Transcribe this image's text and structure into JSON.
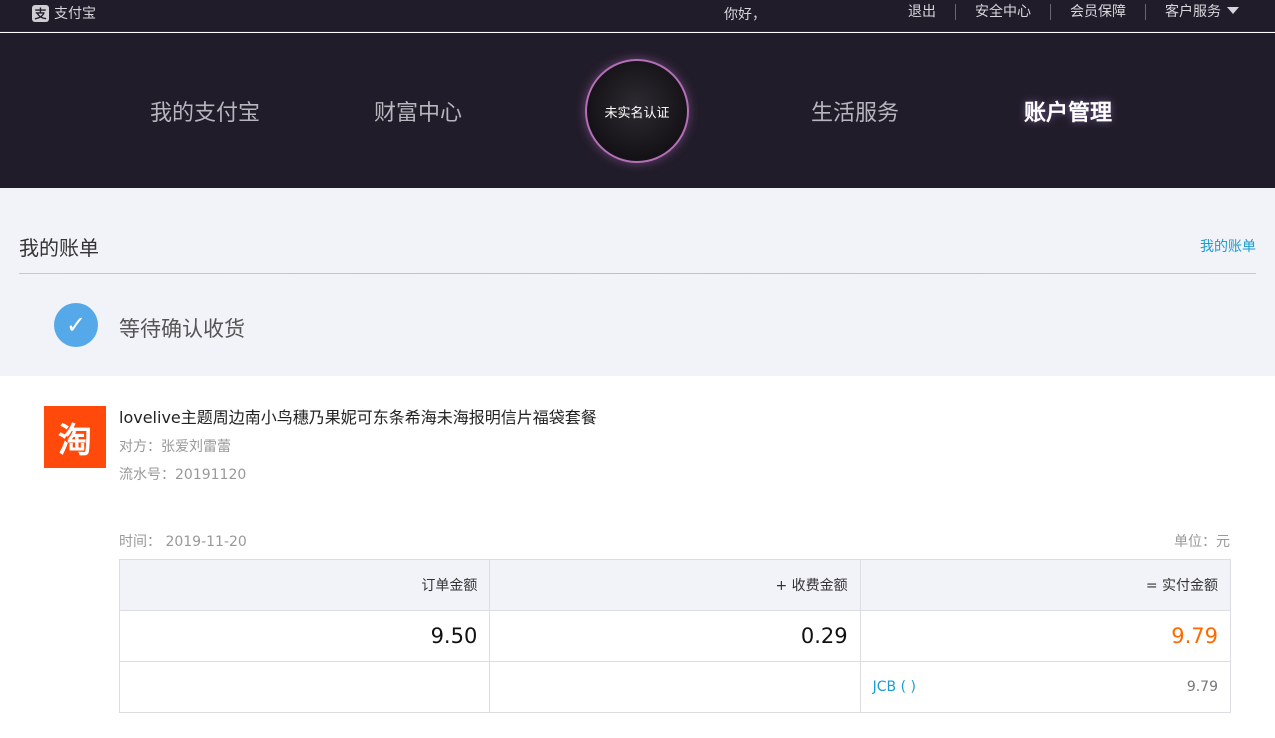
{
  "topbar": {
    "logo_icon": "支",
    "logo_text": "支付宝",
    "greeting": "你好，",
    "links": [
      "退出",
      "安全中心",
      "会员保障",
      "客户服务"
    ]
  },
  "nav": {
    "items": [
      "我的支付宝",
      "财富中心",
      "生活服务",
      "账户管理"
    ],
    "active": "账户管理",
    "avatar_label": "未实名认证"
  },
  "section": {
    "title": "我的账单",
    "link": "我的账单",
    "status": "等待确认收货",
    "status_icon": "check-icon"
  },
  "item": {
    "shop_icon": "淘",
    "title": "lovelive主题周边南小鸟穗乃果妮可东条希海未海报明信片福袋套餐",
    "counterparty": "对方：张爱刘雷蕾",
    "serial": "流水号：20191120"
  },
  "summary": {
    "time": "时间：  2019-11-20",
    "unit": "单位：元",
    "headers": [
      "订单金额",
      "+ 收费金额",
      "= 实付金额"
    ],
    "values": [
      "9.50",
      "0.29",
      "9.79"
    ],
    "payment_method": "JCB (      )",
    "payment_amount": "9.79"
  },
  "colors": {
    "header_bg": "#211c2a",
    "accent_blue": "#1a9ed1",
    "total_orange": "#ff6a00",
    "taobao_orange": "#ff4a0c",
    "check_blue": "#55a9e8"
  }
}
